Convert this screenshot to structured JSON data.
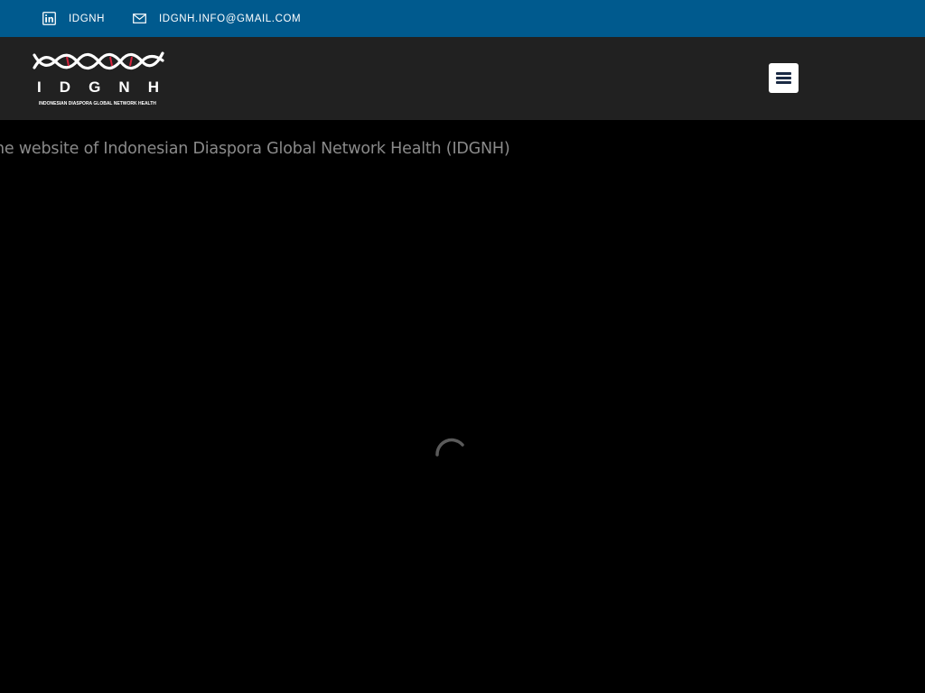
{
  "topbar": {
    "linkedin_label": "IDGNH",
    "email_label": "IDGNH.INFO@GMAIL.COM",
    "background_color": "#005a8e",
    "linkedin_icon": "linkedin-icon",
    "email_icon": "envelope-icon"
  },
  "header": {
    "logo": {
      "letters": [
        "I",
        "D",
        "G",
        "N",
        "H"
      ],
      "subtitle": "INDONESIAN DIASPORA GLOBAL NETWORK HEALTH",
      "icon": "dna-helix-icon"
    },
    "menu_icon": "hamburger-menu-icon",
    "background_color": "#212121"
  },
  "content": {
    "marquee_text": "he website of Indonesian Diaspora Global Network Health (IDGNH)",
    "loading_icon": "loading-spinner-icon"
  }
}
